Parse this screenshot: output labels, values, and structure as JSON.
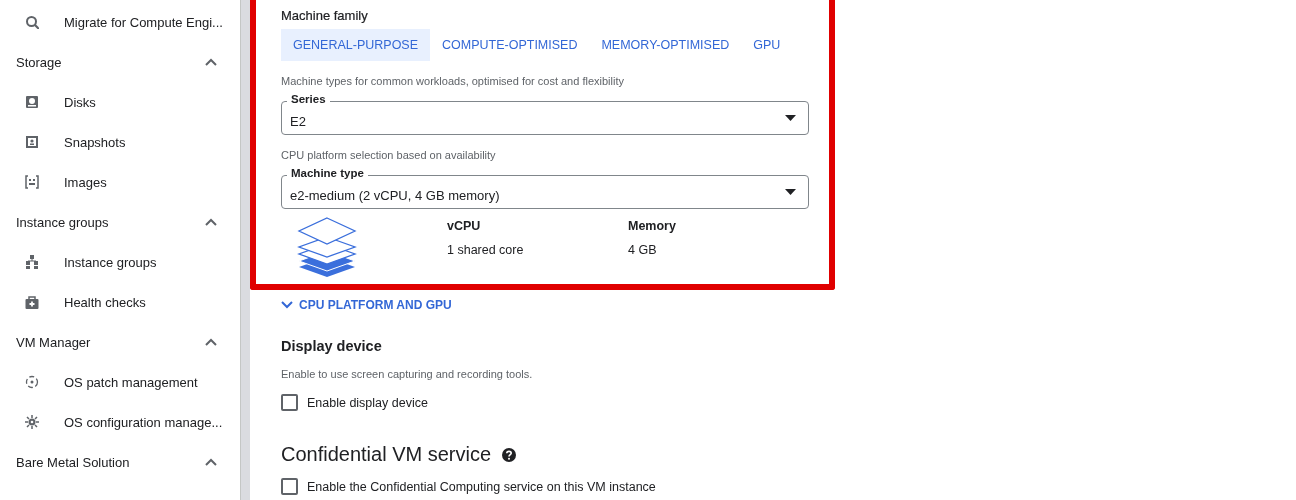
{
  "sidebar": [
    {
      "kind": "item",
      "label": "Migrate for Compute Engi..."
    },
    {
      "kind": "section",
      "label": "Storage",
      "expanded": true,
      "children": [
        {
          "label": "Disks"
        },
        {
          "label": "Snapshots"
        },
        {
          "label": "Images"
        }
      ]
    },
    {
      "kind": "section",
      "label": "Instance groups",
      "expanded": true,
      "children": [
        {
          "label": "Instance groups"
        },
        {
          "label": "Health checks"
        }
      ]
    },
    {
      "kind": "section",
      "label": "VM Manager",
      "expanded": true,
      "children": [
        {
          "label": "OS patch management"
        },
        {
          "label": "OS configuration manage..."
        }
      ]
    },
    {
      "kind": "section",
      "label": "Bare Metal Solution",
      "expanded": true
    }
  ],
  "machine_family": {
    "label": "Machine family",
    "tabs": [
      {
        "label": "GENERAL-PURPOSE",
        "selected": true
      },
      {
        "label": "COMPUTE-OPTIMISED",
        "selected": false
      },
      {
        "label": "MEMORY-OPTIMISED",
        "selected": false
      },
      {
        "label": "GPU",
        "selected": false
      }
    ],
    "hint": "Machine types for common workloads, optimised for cost and flexibility"
  },
  "series": {
    "label": "Series",
    "value": "E2",
    "hint": "CPU platform selection based on availability"
  },
  "machine_type": {
    "label": "Machine type",
    "value": "e2-medium (2 vCPU, 4 GB memory)"
  },
  "specs": [
    {
      "heading": "vCPU",
      "value": "1 shared core"
    },
    {
      "heading": "Memory",
      "value": "4 GB"
    }
  ],
  "cpu_platform_link": {
    "label": "CPU PLATFORM AND GPU",
    "expanded": false
  },
  "display_device": {
    "title": "Display device",
    "description": "Enable to use screen capturing and recording tools.",
    "checkbox": {
      "label": "Enable display device",
      "checked": false
    }
  },
  "confidential": {
    "title": "Confidential VM service",
    "checkbox": {
      "label": "Enable the Confidential Computing service on this VM instance",
      "checked": false
    }
  }
}
